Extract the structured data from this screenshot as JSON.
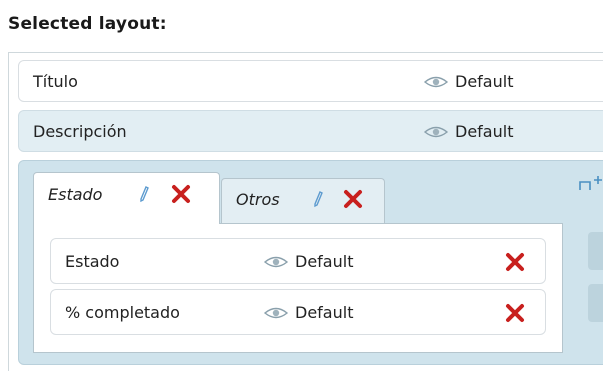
{
  "heading": "Selected layout:",
  "rows": [
    {
      "label": "Título",
      "visibility": "Default"
    },
    {
      "label": "Descripción",
      "visibility": "Default"
    }
  ],
  "tabs": [
    {
      "label": "Estado",
      "active": true
    },
    {
      "label": "Otros",
      "active": false
    }
  ],
  "fields": [
    {
      "label": "Estado",
      "visibility": "Default"
    },
    {
      "label": "% completado",
      "visibility": "Default"
    }
  ],
  "colors": {
    "accent": "#4a90c2",
    "remove": "#c8201e",
    "group_bg": "#cfe3ec"
  },
  "icons": {
    "visibility": "eye-icon",
    "edit": "pencil-icon",
    "remove": "close-icon",
    "add": "add-tab-icon"
  }
}
